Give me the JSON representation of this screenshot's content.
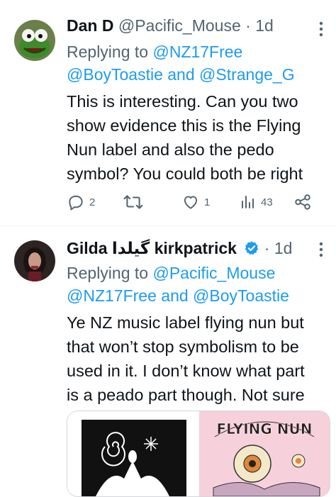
{
  "tweets": [
    {
      "name": "Dan D",
      "handle": "@Pacific_Mouse",
      "separator": "·",
      "time": "1d",
      "replying_prefix": "Replying to",
      "reply_line1_mention": "@NZ17Free",
      "reply_line2_mention_a": "@BoyToastie",
      "reply_and": "and",
      "reply_line2_mention_b": "@Strange_G",
      "text_lines": [
        "This is interesting.  Can you two",
        "show evidence this is the Flying",
        "Nun label and also the pedo",
        "symbol? You could both be right"
      ],
      "counts": {
        "replies": "2",
        "retweets": "",
        "likes": "1",
        "views": "43"
      },
      "avatar_icon": "kermit-avatar"
    },
    {
      "name": "Gilda گیلدا kirkpatrick",
      "separator": "·",
      "time": "1d",
      "replying_prefix": "Replying to",
      "reply_line1_mention": "@Pacific_Mouse",
      "reply_line2_mention_a": "@NZ17Free",
      "reply_and": "and",
      "reply_line2_mention_b": "@BoyToastie",
      "text_lines": [
        "Ye NZ music label flying nun but",
        "that won’t stop symbolism to be",
        "used in it. I don’t know what part",
        "is a peado part though. Not sure"
      ],
      "media": {
        "right_image_text": "FLYING NUN"
      },
      "avatar_icon": "woman-avatar"
    }
  ],
  "colors": {
    "accent": "#1d9bf0",
    "muted": "#536471",
    "text": "#0f1419"
  }
}
